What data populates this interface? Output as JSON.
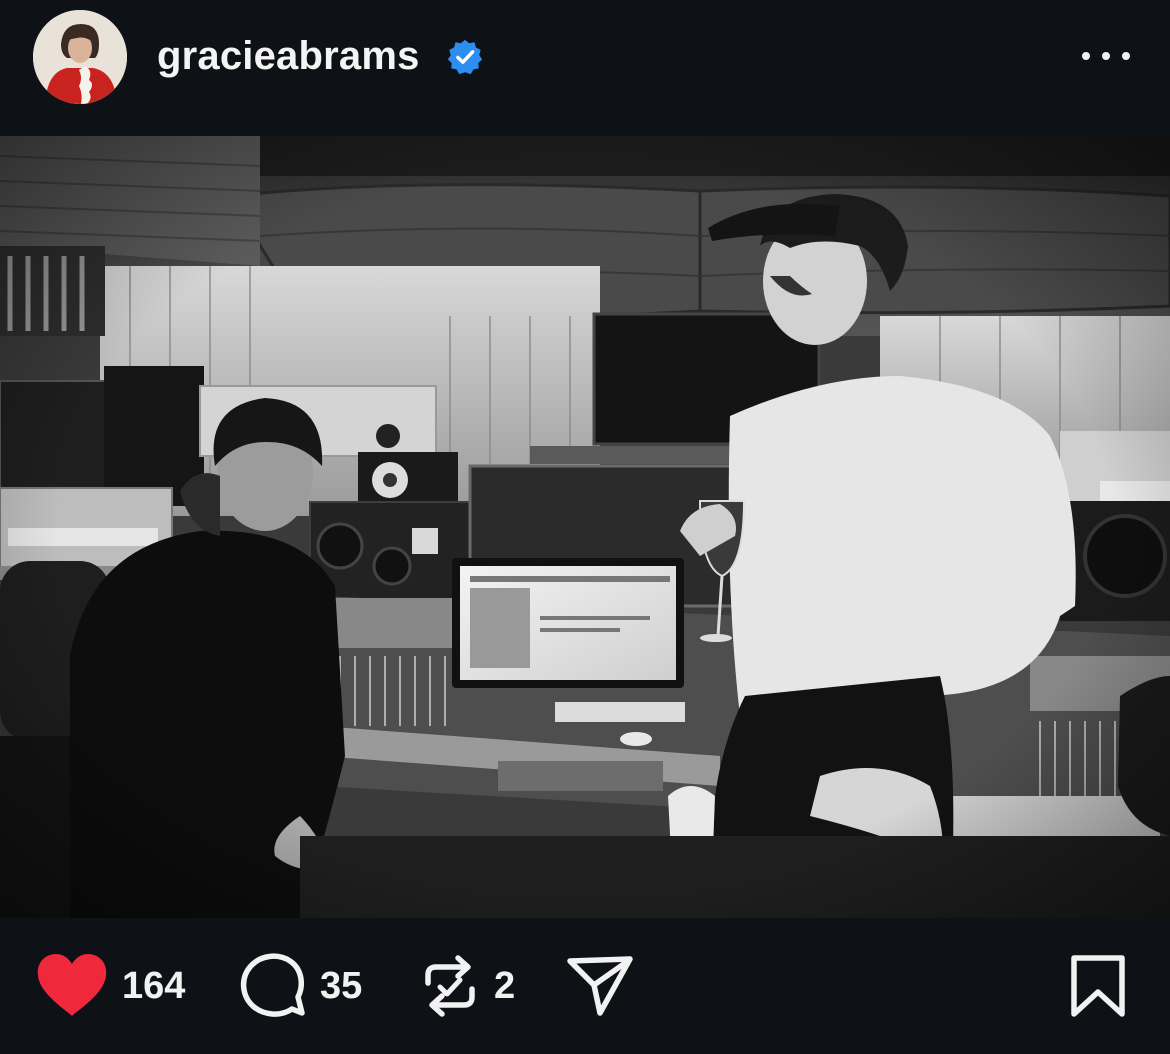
{
  "post": {
    "username": "gracieabrams",
    "verified": true,
    "avatar_icon": "profile-avatar",
    "more_icon": "more-horizontal-icon",
    "photo_description_icon": "post-image",
    "style": "black-and-white"
  },
  "actions": {
    "like": {
      "icon": "heart-icon",
      "count": "164",
      "liked": true,
      "color": "#f0283c"
    },
    "comment": {
      "icon": "comment-icon",
      "count": "35"
    },
    "repost": {
      "icon": "repost-icon",
      "count": "2"
    },
    "share": {
      "icon": "send-icon"
    },
    "save": {
      "icon": "bookmark-icon"
    }
  },
  "colors": {
    "background": "#0e1116",
    "text": "#f2f2f2",
    "verified_blue": "#2b8ef0",
    "like_red": "#f0283c"
  }
}
